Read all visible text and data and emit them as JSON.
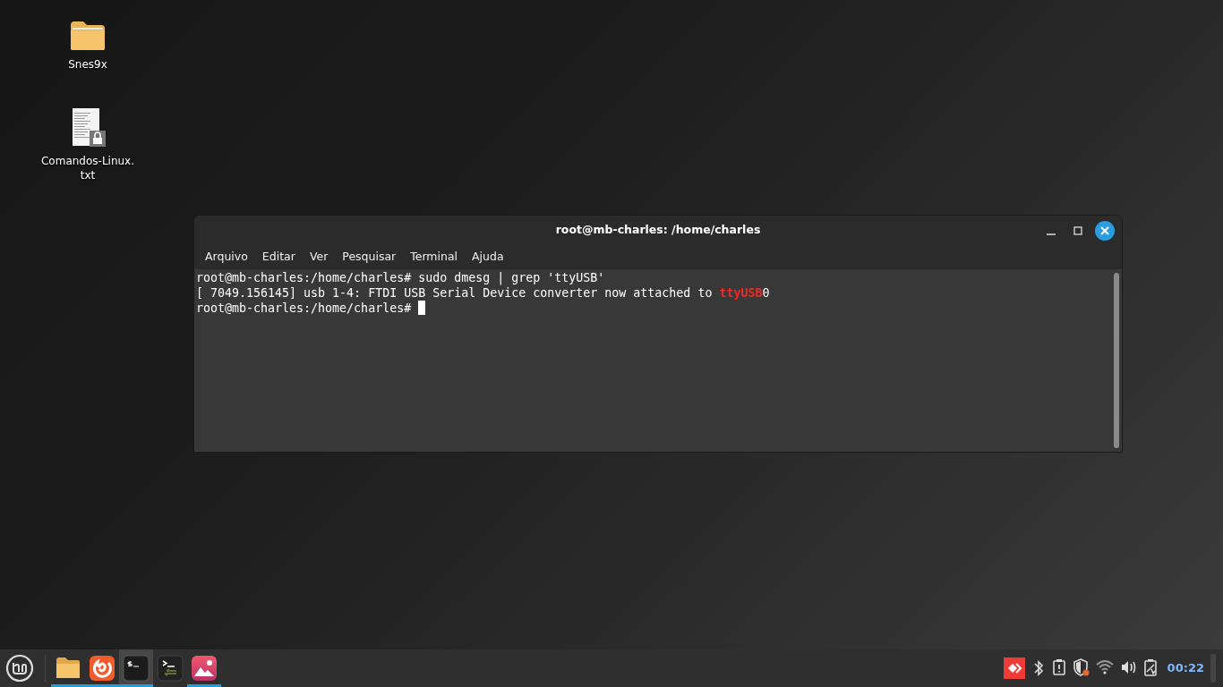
{
  "desktop_icons": [
    {
      "kind": "folder",
      "label": "Snes9x"
    },
    {
      "kind": "locked-text-file",
      "label": "Comandos-Linux.\ntxt"
    }
  ],
  "window": {
    "title": "root@mb-charles: /home/charles",
    "focused": true
  },
  "menu": [
    "Arquivo",
    "Editar",
    "Ver",
    "Pesquisar",
    "Terminal",
    "Ajuda"
  ],
  "terminal_lines": [
    {
      "segments": [
        {
          "text": "root@mb-charles:/home/charles# sudo dmesg | grep 'ttyUSB'",
          "highlight": false
        }
      ]
    },
    {
      "segments": [
        {
          "text": "[ 7049.156145] usb 1-4: FTDI USB Serial Device converter now attached to ",
          "highlight": false
        },
        {
          "text": "ttyUSB",
          "highlight": true
        },
        {
          "text": "0",
          "highlight": false
        }
      ]
    },
    {
      "segments": [
        {
          "text": "root@mb-charles:/home/charles# ",
          "highlight": false
        }
      ],
      "cursor": true
    }
  ],
  "taskbar": {
    "apps": [
      {
        "kind": "files",
        "running": true,
        "selected": false
      },
      {
        "kind": "browser",
        "running": true,
        "selected": false
      },
      {
        "kind": "terminal",
        "running": true,
        "selected": true
      },
      {
        "kind": "terminal-alt",
        "running": false,
        "selected": false
      },
      {
        "kind": "image-viewer",
        "running": true,
        "selected": false
      }
    ],
    "tray": [
      {
        "kind": "remote-desktop"
      },
      {
        "kind": "bluetooth"
      },
      {
        "kind": "clipboard"
      },
      {
        "kind": "shield"
      },
      {
        "kind": "wifi"
      },
      {
        "kind": "volume"
      },
      {
        "kind": "battery"
      }
    ],
    "clock": "00:22"
  }
}
